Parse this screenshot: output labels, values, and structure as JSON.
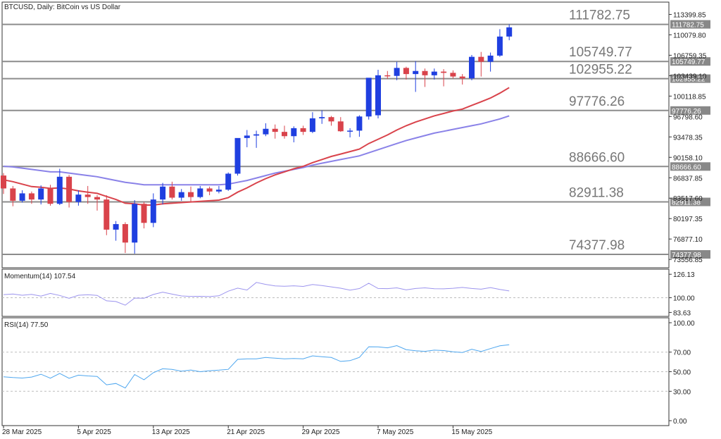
{
  "header": {
    "title": "BTCUSD, Daily:  BitCoin vs US Dollar"
  },
  "colors": {
    "bull": "#1f3fe0",
    "bear": "#d9434b",
    "ema_fast": "#d9434b",
    "ema_slow": "#8a82e8",
    "level_line": "#8c8c8c",
    "level_text": "#777777",
    "momentum": "#9c94ee",
    "rsi": "#4da6ef",
    "axis_text": "#222222",
    "border": "#333333"
  },
  "price_axis": {
    "ticks": [
      "113399.85",
      "110079.80",
      "106759.35",
      "103439.10",
      "100118.85",
      "96798.60",
      "93478.35",
      "90158.10",
      "86837.85",
      "83517.60",
      "80197.35",
      "76877.10",
      "73556.85"
    ]
  },
  "levels": [
    {
      "label": "111782.75",
      "value": 111782.75,
      "tag": "111782.75"
    },
    {
      "label": "105749.77",
      "value": 105749.77,
      "tag": "105749.77"
    },
    {
      "label": "102955.22",
      "value": 102955.22,
      "tag": "102955.22"
    },
    {
      "label": "97776.26",
      "value": 97776.26,
      "tag": "97776.26"
    },
    {
      "label": "88666.60",
      "value": 88666.6,
      "tag": "88666.60"
    },
    {
      "label": "82911.38",
      "value": 82911.38,
      "tag": "82911.38"
    },
    {
      "label": "74377.98",
      "value": 74377.98,
      "tag": "74377.98"
    }
  ],
  "date_axis": {
    "labels": [
      {
        "text": "28 Mar 2025",
        "index": 0
      },
      {
        "text": "5 Apr 2025",
        "index": 8
      },
      {
        "text": "13 Apr 2025",
        "index": 16
      },
      {
        "text": "21 Apr 2025",
        "index": 24
      },
      {
        "text": "29 Apr 2025",
        "index": 32
      },
      {
        "text": "7 May 2025",
        "index": 40
      },
      {
        "text": "15 May 2025",
        "index": 48
      }
    ]
  },
  "momentum_panel": {
    "title": "Momentum(14) 107.54",
    "ticks": [
      "126.13",
      "100.00",
      "83.63"
    ]
  },
  "rsi_panel": {
    "title": "RSI(14) 77.50",
    "ticks": [
      "100.00",
      "70.00",
      "50.00",
      "30.00",
      "0.00"
    ]
  },
  "chart_data": {
    "type": "candlestick",
    "symbol": "BTCUSD",
    "timeframe": "Daily",
    "price_range": [
      72200,
      115400
    ],
    "dates_start": "2025-03-27",
    "candles": [
      [
        87200,
        87600,
        84200,
        85100
      ],
      [
        85100,
        85500,
        82200,
        83100
      ],
      [
        83100,
        84800,
        82800,
        84300
      ],
      [
        84300,
        84600,
        82600,
        83300
      ],
      [
        83300,
        85600,
        82500,
        85100
      ],
      [
        85100,
        85700,
        82300,
        82600
      ],
      [
        82600,
        88300,
        82400,
        87000
      ],
      [
        87000,
        87300,
        82000,
        82900
      ],
      [
        82900,
        84800,
        82300,
        84100
      ],
      [
        84100,
        85500,
        82600,
        83700
      ],
      [
        83700,
        84000,
        81500,
        83300
      ],
      [
        83300,
        84000,
        77500,
        78400
      ],
      [
        78400,
        79800,
        76600,
        79300
      ],
      [
        79300,
        79600,
        74600,
        76300
      ],
      [
        76300,
        83200,
        74500,
        82600
      ],
      [
        82600,
        82900,
        78600,
        79500
      ],
      [
        79500,
        84300,
        78800,
        83300
      ],
      [
        83300,
        86000,
        82500,
        85400
      ],
      [
        85400,
        86200,
        83300,
        83600
      ],
      [
        83600,
        85000,
        83100,
        84500
      ],
      [
        84500,
        85400,
        83000,
        83700
      ],
      [
        83700,
        85500,
        83500,
        85100
      ],
      [
        85100,
        85400,
        84000,
        84600
      ],
      [
        84600,
        85500,
        84300,
        84900
      ],
      [
        84900,
        87700,
        84700,
        87500
      ],
      [
        87500,
        88500,
        87200,
        93300
      ],
      [
        93300,
        94600,
        91800,
        93700
      ],
      [
        93700,
        94500,
        91700,
        93900
      ],
      [
        93900,
        95700,
        93600,
        94800
      ],
      [
        94800,
        95500,
        93200,
        94300
      ],
      [
        94300,
        95300,
        93200,
        93600
      ],
      [
        93600,
        95200,
        92600,
        94900
      ],
      [
        94900,
        95300,
        93800,
        94300
      ],
      [
        94300,
        97500,
        94100,
        96500
      ],
      [
        96500,
        97800,
        95600,
        96700
      ],
      [
        96700,
        96900,
        95300,
        96000
      ],
      [
        96000,
        96700,
        94300,
        94400
      ],
      [
        94400,
        94900,
        93400,
        94500
      ],
      [
        94500,
        97000,
        93500,
        96800
      ],
      [
        96800,
        98200,
        96300,
        103100
      ],
      [
        97000,
        104400,
        96500,
        103500
      ],
      [
        103500,
        104200,
        102900,
        103400
      ],
      [
        103400,
        105700,
        102700,
        104700
      ],
      [
        104700,
        104900,
        102800,
        103700
      ],
      [
        103700,
        105800,
        100800,
        104200
      ],
      [
        104200,
        104600,
        101600,
        103500
      ],
      [
        103500,
        104600,
        102800,
        104100
      ],
      [
        104100,
        104500,
        101700,
        103900
      ],
      [
        103900,
        104300,
        103000,
        103300
      ],
      [
        103300,
        103700,
        102000,
        103000
      ],
      [
        103000,
        106800,
        102700,
        106500
      ],
      [
        106500,
        107300,
        103300,
        105700
      ],
      [
        105700,
        107200,
        104100,
        106700
      ],
      [
        106700,
        111000,
        106500,
        109800
      ],
      [
        109800,
        111782,
        109200,
        111300
      ]
    ],
    "ema_fast": [
      86500,
      86200,
      85800,
      85400,
      85300,
      85100,
      85200,
      85000,
      84700,
      84500,
      84300,
      83800,
      83300,
      82700,
      82600,
      82400,
      82400,
      82600,
      82700,
      82800,
      82900,
      83000,
      83100,
      83200,
      83600,
      84500,
      85200,
      86000,
      86700,
      87300,
      87800,
      88300,
      88700,
      89300,
      89800,
      90300,
      90700,
      91100,
      91500,
      92400,
      93100,
      93800,
      94600,
      95300,
      95900,
      96400,
      96900,
      97300,
      97700,
      98000,
      98600,
      99200,
      99800,
      100600,
      101500
    ],
    "ema_slow": [
      88700,
      88600,
      88400,
      88200,
      88000,
      87800,
      87800,
      87600,
      87400,
      87200,
      87000,
      86700,
      86400,
      86100,
      85900,
      85700,
      85700,
      85700,
      85700,
      85700,
      85700,
      85700,
      85700,
      85700,
      85800,
      86100,
      86400,
      86800,
      87200,
      87600,
      87900,
      88200,
      88500,
      88900,
      89200,
      89500,
      89800,
      90100,
      90400,
      90900,
      91400,
      91900,
      92400,
      92900,
      93300,
      93700,
      94100,
      94400,
      94700,
      95000,
      95300,
      95600,
      96000,
      96400,
      96900
    ],
    "momentum": [
      103.5,
      104.1,
      102.8,
      103.7,
      101.8,
      104.8,
      102.5,
      99.4,
      102.8,
      103.4,
      102.6,
      96.6,
      95.8,
      91.7,
      99.6,
      99.5,
      103.6,
      106.2,
      104.0,
      102.0,
      101.5,
      101.6,
      101.3,
      102.1,
      107.3,
      110.7,
      108.6,
      117.0,
      114.8,
      113.2,
      112.8,
      113.3,
      112.6,
      114.7,
      113.5,
      112.1,
      110.6,
      108.4,
      110.2,
      116.1,
      110.3,
      110.1,
      111.0,
      108.7,
      110.3,
      111.0,
      110.0,
      109.9,
      110.5,
      111.5,
      110.3,
      109.5,
      111.3,
      109.2,
      107.54
    ],
    "rsi": [
      44.8,
      44.0,
      43.5,
      44.5,
      47.4,
      43.4,
      48.3,
      43.3,
      46.5,
      45.7,
      45.2,
      36.6,
      38.0,
      33.4,
      47.1,
      41.8,
      49.0,
      53.0,
      52.4,
      50.5,
      51.7,
      50.0,
      51.0,
      51.6,
      52.4,
      62.6,
      63.2,
      63.2,
      64.5,
      63.8,
      63.1,
      63.5,
      63.2,
      66.2,
      65.3,
      64.5,
      60.5,
      61.3,
      64.6,
      75.5,
      75.4,
      74.4,
      76.6,
      72.5,
      71.4,
      70.8,
      72.0,
      71.6,
      70.3,
      69.6,
      72.9,
      70.6,
      73.6,
      76.4,
      77.5
    ]
  }
}
